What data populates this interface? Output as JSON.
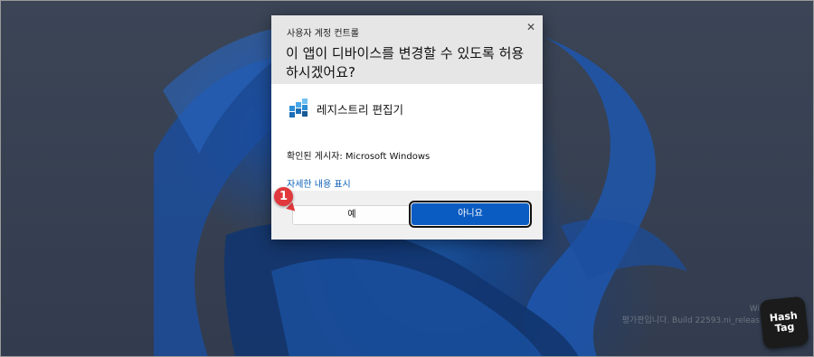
{
  "dialog": {
    "caption": "사용자 계정 컨트롤",
    "question": "이 앱이 디바이스를 변경할 수 있도록 허용하시겠어요?",
    "app_name": "레지스트리 편집기",
    "publisher": "확인된 게시자: Microsoft Windows",
    "details_link": "자세한 내용 표시",
    "yes_label": "예",
    "no_label": "아니요",
    "close_glyph": "✕"
  },
  "annotation": {
    "step": "1",
    "color": "#e0383d"
  },
  "desktop": {
    "watermark_line1": "Wi",
    "watermark_line2": "평가판입니다. Build 22593.ni_releas"
  },
  "brand": {
    "line1": "Hash",
    "line2": "Tag"
  },
  "colors": {
    "accent": "#0b5cc2",
    "link": "#0b5fb5"
  }
}
